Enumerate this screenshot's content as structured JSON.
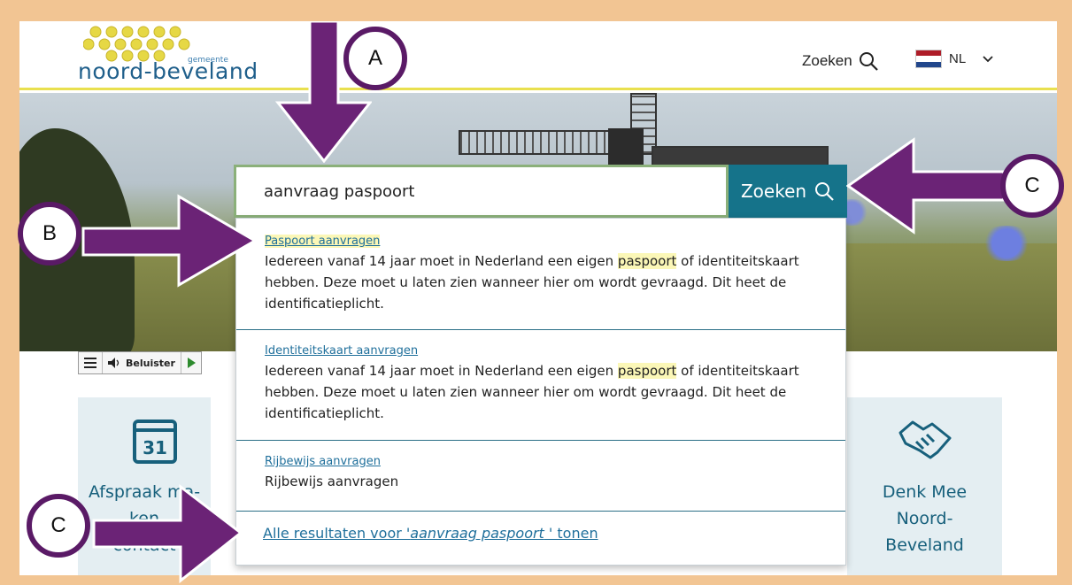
{
  "header": {
    "logo_text": "noord-beveland",
    "logo_sub": "gemeente",
    "search_label": "Zoeken",
    "language": "NL",
    "flag_colors": [
      "#ae1c28",
      "#ffffff",
      "#21468b"
    ]
  },
  "readspeaker": {
    "listen_label": "Beluister"
  },
  "search": {
    "query": "aanvraag paspoort",
    "button_label": "Zoeken"
  },
  "results": [
    {
      "title": "Paspoort aanvragen",
      "desc_pre": "Iedereen vanaf 14 jaar moet in Nederland een eigen ",
      "desc_hl": "paspoort",
      "desc_post": " of identiteitskaart hebben. Deze moet u laten zien wanneer hier om wordt gevraagd. Dit heet de identificatieplicht."
    },
    {
      "title": "Identiteitskaart aanvragen",
      "desc_pre": "Iedereen vanaf 14 jaar moet in Nederland een eigen ",
      "desc_hl": "paspoort",
      "desc_post": " of identiteitskaart hebben. Deze moet u laten zien wanneer hier om wordt gevraagd. Dit heet de identificatieplicht."
    },
    {
      "title": "Rijbewijs aanvragen",
      "desc": "Rijbewijs aanvragen"
    }
  ],
  "all_results": {
    "pre": "Alle resultaten voor '",
    "query": "aanvraag paspoort",
    "post": " ' tonen"
  },
  "tiles": {
    "tile1_day": "31",
    "tile1_title_l1": "Afspraak ma-",
    "tile1_title_l2": "ken",
    "tile1_title_l3": "contact",
    "tile4_title_l1": "Denk Mee",
    "tile4_title_l2": "Noord-",
    "tile4_title_l3": "Beveland"
  },
  "annotations": {
    "a": "A",
    "b": "B",
    "c_top": "C",
    "c_bottom": "C",
    "arrow_color": "#6b2376",
    "badge_border": "#5a1a66"
  },
  "colors": {
    "frame": "#f2c593",
    "accent_teal": "#15738a",
    "header_line": "#e9e04f",
    "highlight": "#fbf7b7"
  }
}
